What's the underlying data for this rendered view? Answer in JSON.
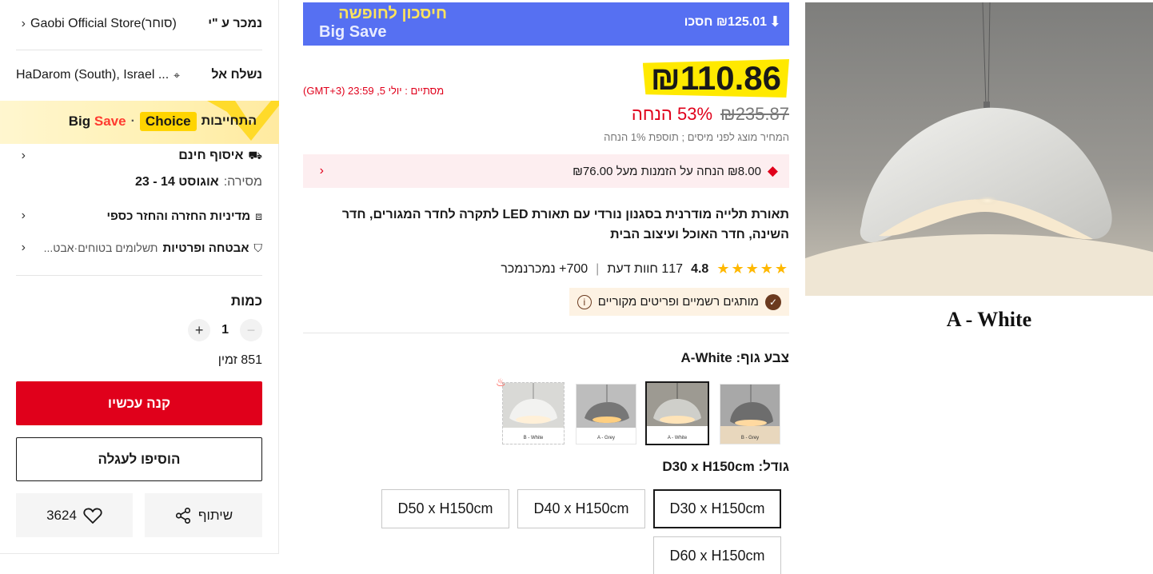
{
  "seller": {
    "label": "נמכר ע \"י",
    "store": "Gaobi Official Store",
    "role": "(סוחר)"
  },
  "shipping": {
    "label": "נשלח אל",
    "location": "HaDarom (South), Israel ..."
  },
  "choice_banner": {
    "commitment": "התחייבות",
    "choice": "Choice",
    "big": "Big",
    "save": "Save",
    "dot": "·"
  },
  "pickup": {
    "title": "איסוף חינם",
    "delivery_label": "מסירה:",
    "delivery_dates": "אוגוסט 14 - 23"
  },
  "returns": {
    "title": "מדיניות החזרה והחזר כספי"
  },
  "security": {
    "title": "אבטחה ופרטיות",
    "subtitle": "תשלומים בטוחים·אבט..."
  },
  "quantity": {
    "label": "כמות",
    "value": "1",
    "minus": "−",
    "plus": "+",
    "available": "851 זמין"
  },
  "actions": {
    "buy_now": "קנה עכשיו",
    "add_to_cart": "הוסיפו לעגלה",
    "share": "שיתוף",
    "wishlist_count": "3624"
  },
  "promo": {
    "title": "חיסכון לחופשה",
    "subtitle": "Big Save",
    "save_text": "₪125.01 חסכו"
  },
  "price": {
    "current": "₪110.86",
    "original": "₪235.87",
    "discount": "53% הנחה",
    "tax_note": "המחיר מוצג לפני מיסים ; תוספת 1% הנחה"
  },
  "timer": {
    "label": "מסתיים :",
    "value": "יולי 5, 23:59 (GMT+3)"
  },
  "coupon": {
    "text": "₪8.00 הנחה על הזמנות מעל ₪76.00"
  },
  "product": {
    "title": "תאורת תלייה מודרנית בסגנון נורדי עם תאורת LED לתקרה לחדר המגורים, חדר השינה, חדר האוכל ועיצוב הבית"
  },
  "rating": {
    "stars": "★★★★★",
    "score": "4.8",
    "reviews": "117 חוות דעת",
    "sold": "700+ נמכרנמכר",
    "separator": "|"
  },
  "official_badge": {
    "text": "מותגים רשמיים ופריטים מקוריים"
  },
  "color_option": {
    "label": "צבע גוף:",
    "selected": "A-White",
    "swatches": [
      "B - Grey",
      "A - White",
      "A - Grey",
      "B - White"
    ]
  },
  "size_option": {
    "label": "גודל:",
    "selected": "D30 x H150cm",
    "sizes": [
      "D30 x H150cm",
      "D40 x H150cm",
      "D50 x H150cm",
      "D60 x H150cm"
    ]
  },
  "image": {
    "caption": "A - White"
  },
  "colors": {
    "accent_red": "#e0001b",
    "promo_blue": "#5670f2",
    "price_yellow": "#ffe900",
    "star": "#ffb800"
  }
}
